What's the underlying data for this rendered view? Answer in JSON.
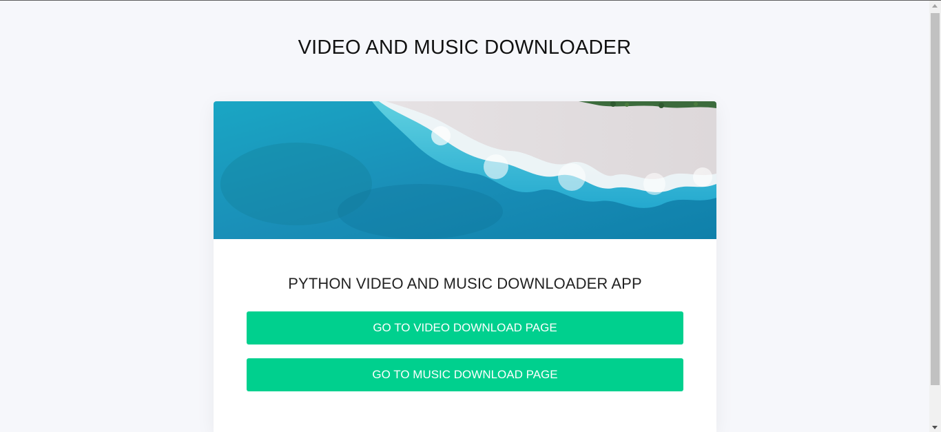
{
  "header": {
    "title": "VIDEO AND MUSIC DOWNLOADER"
  },
  "card": {
    "image_icon": "ocean-beach-aerial-image",
    "subtitle": "PYTHON VIDEO AND MUSIC DOWNLOADER APP",
    "video_button_label": "GO TO VIDEO DOWNLOAD PAGE",
    "music_button_label": "GO TO MUSIC DOWNLOAD PAGE"
  },
  "colors": {
    "page_background": "#f6f7fb",
    "button_background": "#00d08e",
    "button_text": "#ffffff",
    "title_text": "#111111"
  }
}
